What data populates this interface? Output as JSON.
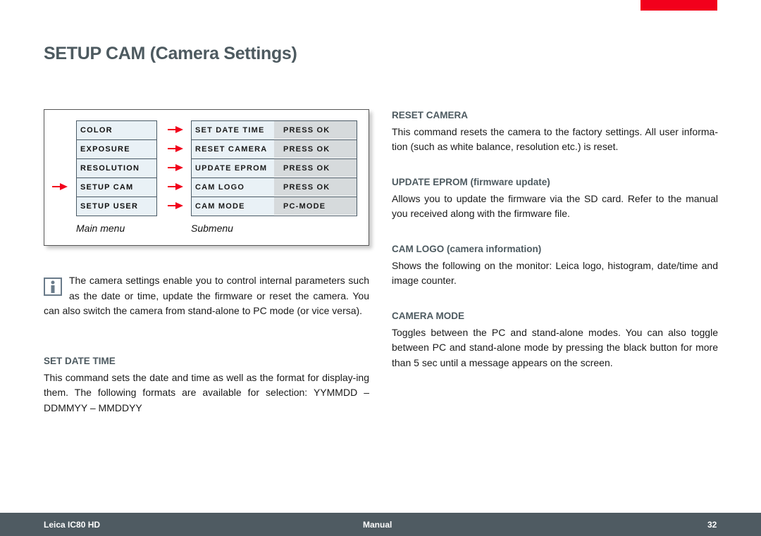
{
  "page": {
    "title": "SETUP CAM (Camera Settings)",
    "accent_color": "#f2001c"
  },
  "figure": {
    "main_menu": {
      "caption": "Main menu",
      "items": [
        "COLOR",
        "EXPOSURE",
        "RESOLUTION",
        "SETUP CAM",
        "SETUP USER"
      ],
      "selected_index": 3
    },
    "submenu": {
      "caption": "Submenu",
      "items": [
        {
          "name": "SET DATE TIME",
          "value": "PRESS OK"
        },
        {
          "name": "RESET CAMERA",
          "value": "PRESS OK"
        },
        {
          "name": "UPDATE EPROM",
          "value": "PRESS OK"
        },
        {
          "name": "CAM LOGO",
          "value": "PRESS OK"
        },
        {
          "name": "CAM MODE",
          "value": "PC-MODE"
        }
      ]
    },
    "arrow_icon": "arrow-right-icon"
  },
  "note": {
    "icon": "info-icon",
    "text": "The camera settings enable you to control internal parameters such as the date or time, update the firmware or reset the camera. You can also switch the camera from stand-alone to PC mode (or vice versa)."
  },
  "sections": {
    "set_date_time": {
      "heading": "SET DATE TIME",
      "body": "This command sets the date and time as well as the format for display-ing them. The following formats are available for selection: YYMMDD – DDMMYY – MMDDYY"
    },
    "reset_camera": {
      "heading": "RESET CAMERA",
      "body": "This command resets the camera to the factory settings. All user informa-tion (such as white balance, resolution etc.) is reset."
    },
    "update_eprom": {
      "heading": "UPDATE EPROM (firmware update)",
      "body": "Allows you to update the firmware via the SD card. Refer to the manual you received along with the firmware file."
    },
    "cam_logo": {
      "heading": "CAM LOGO (camera information)",
      "body": "Shows the following on the monitor: Leica logo, histogram, date/time and image counter."
    },
    "camera_mode": {
      "heading": "CAMERA MODE",
      "body": "Toggles between the PC and stand-alone modes. You can also toggle between PC and stand-alone mode by pressing the black button for more than 5 sec until a message appears on the screen."
    }
  },
  "footer": {
    "product": "Leica IC80 HD",
    "doc_type": "Manual",
    "page_number": "32"
  }
}
